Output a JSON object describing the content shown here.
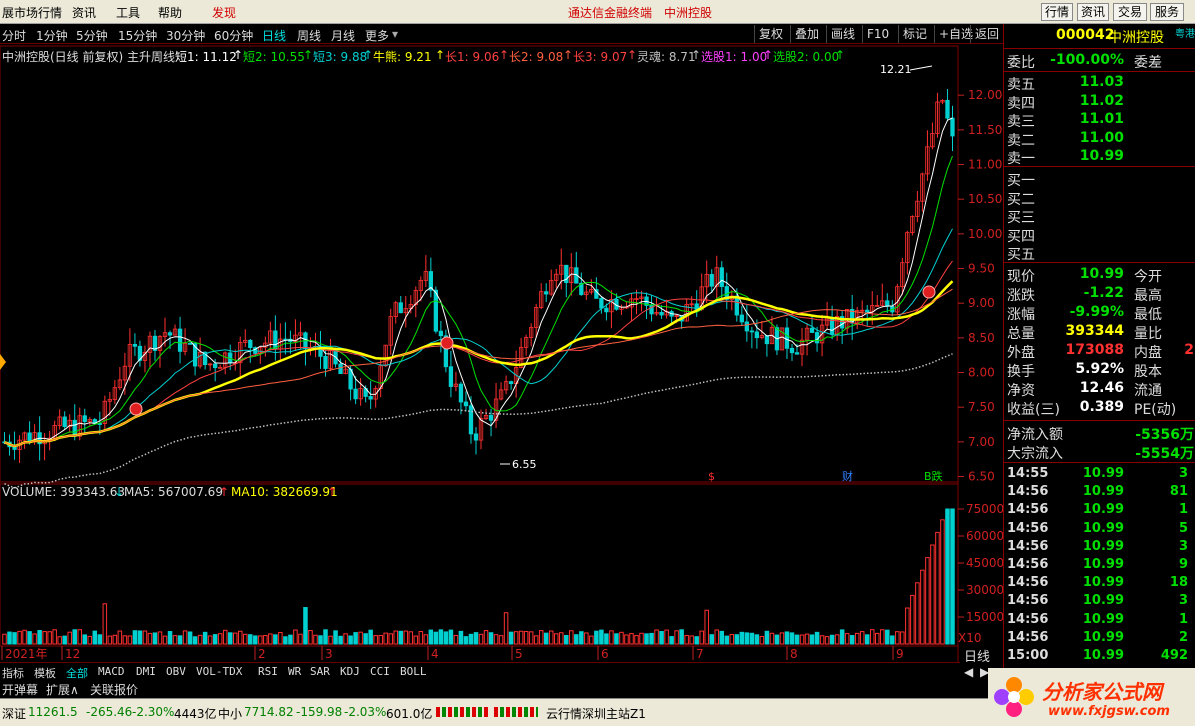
{
  "menu": {
    "items": [
      "展市场行情",
      "资讯",
      "工具",
      "帮助",
      "发现"
    ],
    "title_left": "通达信金融终端",
    "title_right": "中洲控股",
    "right_buttons": [
      "行情",
      "资讯",
      "交易",
      "服务"
    ]
  },
  "periods": {
    "items": [
      "分时",
      "1分钟",
      "5分钟",
      "15分钟",
      "30分钟",
      "60分钟",
      "日线",
      "周线",
      "月线",
      "更多"
    ],
    "active": 6
  },
  "toolbar": {
    "items": [
      "复权",
      "叠加",
      "画线",
      "F10",
      "标记",
      "+自选",
      "返回"
    ]
  },
  "legend": {
    "name": "中洲控股(日线 前复权) 主升周线",
    "items": [
      {
        "label": "短1: 11.12",
        "color": "#ffffff"
      },
      {
        "label": "短2: 10.55",
        "color": "#00e000"
      },
      {
        "label": "短3: 9.88",
        "color": "#00d0d0"
      },
      {
        "label": "牛熊: 9.21",
        "color": "#ffff00"
      },
      {
        "label": "长1: 9.06",
        "color": "#ff4040"
      },
      {
        "label": "长2: 9.08",
        "color": "#ff6040"
      },
      {
        "label": "长3: 9.07",
        "color": "#ff4040"
      },
      {
        "label": "灵魂: 8.71",
        "color": "#c0c0c0"
      },
      {
        "label": "选股1: 1.00",
        "color": "#ff40ff"
      },
      {
        "label": "选股2: 0.00",
        "color": "#00e000"
      }
    ]
  },
  "chart_data": {
    "type": "candlestick",
    "x_ticks": [
      "2021年",
      "12",
      "2",
      "3",
      "4",
      "5",
      "6",
      "7",
      "8",
      "9"
    ],
    "ylim": [
      6.45,
      12.45
    ],
    "y_ticks": [
      "12.00",
      "11.50",
      "11.00",
      "10.50",
      "10.00",
      "9.50",
      "9.00",
      "8.50",
      "8.00",
      "7.50",
      "7.00",
      "6.50"
    ],
    "high_label": "12.21",
    "low_label": "6.55",
    "markers": [
      {
        "text": "$",
        "color": "#ff3030"
      },
      {
        "text": "财",
        "color": "#3080ff"
      },
      {
        "text": "B跌",
        "color": "#00e000"
      }
    ],
    "volume": {
      "label": "VOLUME: 393343.63",
      "ma5": "MA5: 567007.69",
      "ma10": "MA10: 382669.91",
      "y_ticks": [
        "75000",
        "60000",
        "45000",
        "30000",
        "15000"
      ],
      "unit": "X10",
      "ylim": [
        0,
        80000
      ]
    }
  },
  "indicators": {
    "items": [
      "指标",
      "模板",
      "全部",
      "MACD",
      "DMI",
      "OBV",
      "VOL-TDX",
      "RSI",
      "WR",
      "SAR",
      "KDJ",
      "CCI",
      "BOLL"
    ],
    "active": 2
  },
  "subbar": {
    "items": [
      "开弹幕",
      "扩展∧",
      "关联报价"
    ],
    "period_label": "日线"
  },
  "panel": {
    "code": "000042",
    "name": "中洲控股",
    "tag": "粤港",
    "weibi": {
      "label": "委比",
      "value": "-100.00%",
      "label2": "委差"
    },
    "sells": [
      {
        "label": "卖五",
        "price": "11.03"
      },
      {
        "label": "卖四",
        "price": "11.02"
      },
      {
        "label": "卖三",
        "price": "11.01"
      },
      {
        "label": "卖二",
        "price": "11.00"
      },
      {
        "label": "卖一",
        "price": "10.99"
      }
    ],
    "buys": [
      "买一",
      "买二",
      "买三",
      "买四",
      "买五"
    ],
    "stats": [
      {
        "l": "现价",
        "v": "10.99",
        "vc": "#00e000",
        "l2": "今开"
      },
      {
        "l": "涨跌",
        "v": "-1.22",
        "vc": "#00e000",
        "l2": "最高"
      },
      {
        "l": "涨幅",
        "v": "-9.99%",
        "vc": "#00e000",
        "l2": "最低"
      },
      {
        "l": "总量",
        "v": "393344",
        "vc": "#ffff00",
        "l2": "量比"
      },
      {
        "l": "外盘",
        "v": "173088",
        "vc": "#ff3030",
        "l2": "内盘",
        "v2": "2"
      },
      {
        "l": "换手",
        "v": "5.92%",
        "vc": "#ffffff",
        "l2": "股本"
      },
      {
        "l": "净资",
        "v": "12.46",
        "vc": "#ffffff",
        "l2": "流通"
      },
      {
        "l": "收益(三)",
        "v": "0.389",
        "vc": "#ffffff",
        "l2": "PE(动)"
      }
    ],
    "flows": [
      {
        "l": "净流入额",
        "v": "-5356万"
      },
      {
        "l": "大宗流入",
        "v": "-5554万"
      }
    ],
    "ticks": [
      {
        "t": "14:55",
        "p": "10.99",
        "q": "3"
      },
      {
        "t": "14:56",
        "p": "10.99",
        "q": "81"
      },
      {
        "t": "14:56",
        "p": "10.99",
        "q": "1"
      },
      {
        "t": "14:56",
        "p": "10.99",
        "q": "5"
      },
      {
        "t": "14:56",
        "p": "10.99",
        "q": "3"
      },
      {
        "t": "14:56",
        "p": "10.99",
        "q": "9"
      },
      {
        "t": "14:56",
        "p": "10.99",
        "q": "18"
      },
      {
        "t": "14:56",
        "p": "10.99",
        "q": "3"
      },
      {
        "t": "14:56",
        "p": "10.99",
        "q": "1"
      },
      {
        "t": "14:56",
        "p": "10.99",
        "q": "2"
      },
      {
        "t": "15:00",
        "p": "10.99",
        "q": "492"
      }
    ]
  },
  "status": {
    "sz_label": "深证",
    "sz_value": "11261.5",
    "sz_change": "-265.46",
    "sz_pct": "-2.30%",
    "sz_amount": "4443亿",
    "zx_label": "中小",
    "zx_value": "7714.82",
    "zx_change": "-159.98",
    "zx_pct": "-2.03%",
    "zx_amount": "601.0亿",
    "server": "云行情深圳主站Z1"
  },
  "logo": {
    "text": "分析家公式网",
    "url": "www.fxjgsw.com"
  },
  "colors": {
    "up": "#ff3030",
    "down": "#00d0d0",
    "bull": "#ffff00",
    "panel_border": "#800000"
  }
}
